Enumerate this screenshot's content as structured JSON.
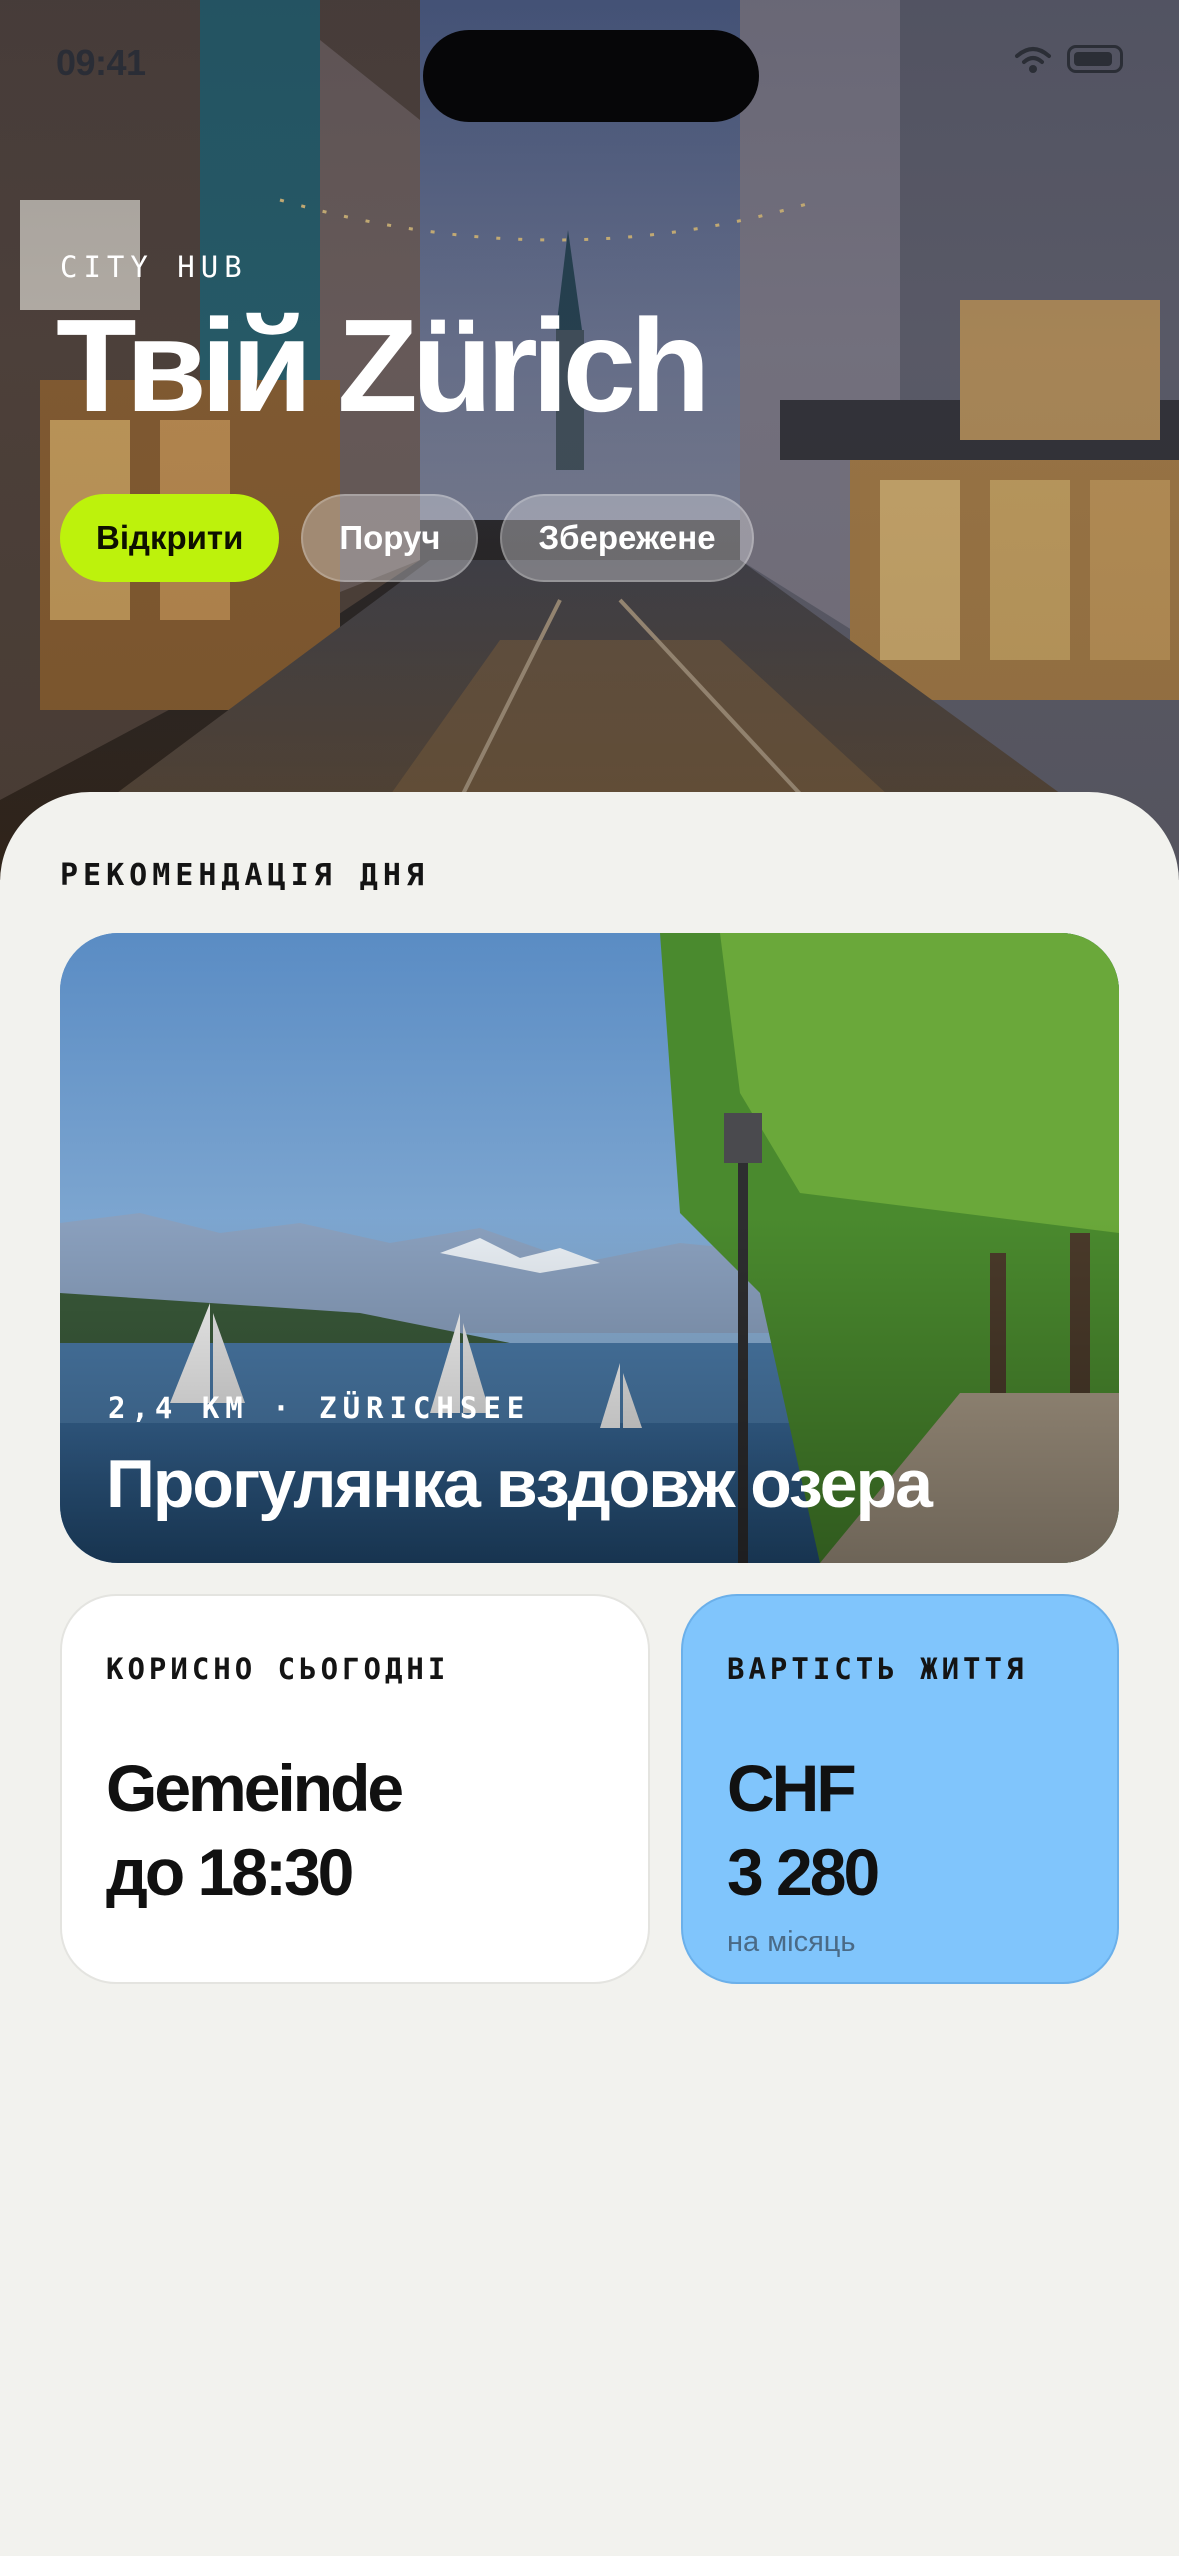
{
  "status_bar": {
    "time": "09:41"
  },
  "hero": {
    "eyebrow": "CITY HUB",
    "title": "Твій Zürich",
    "pills": [
      "Відкрити",
      "Поруч",
      "Збережене"
    ]
  },
  "recommendation": {
    "section_label": "РЕКОМЕНДАЦІЯ ДНЯ",
    "meta": "2,4 KM · ZÜRICHSEE",
    "title": "Прогулянка вздовж озера"
  },
  "useful_today": {
    "label": "КОРИСНО СЬОГОДНІ",
    "line1": "Gemeinde",
    "line2": "до 18:30"
  },
  "cost_of_living": {
    "label": "ВАРТІСТЬ ЖИТТЯ",
    "currency": "CHF",
    "amount": "3 280",
    "period": "на місяць"
  },
  "colors": {
    "accent": "#bdf20c",
    "card_blue": "#80c5fc",
    "background": "#f2f2ee"
  }
}
